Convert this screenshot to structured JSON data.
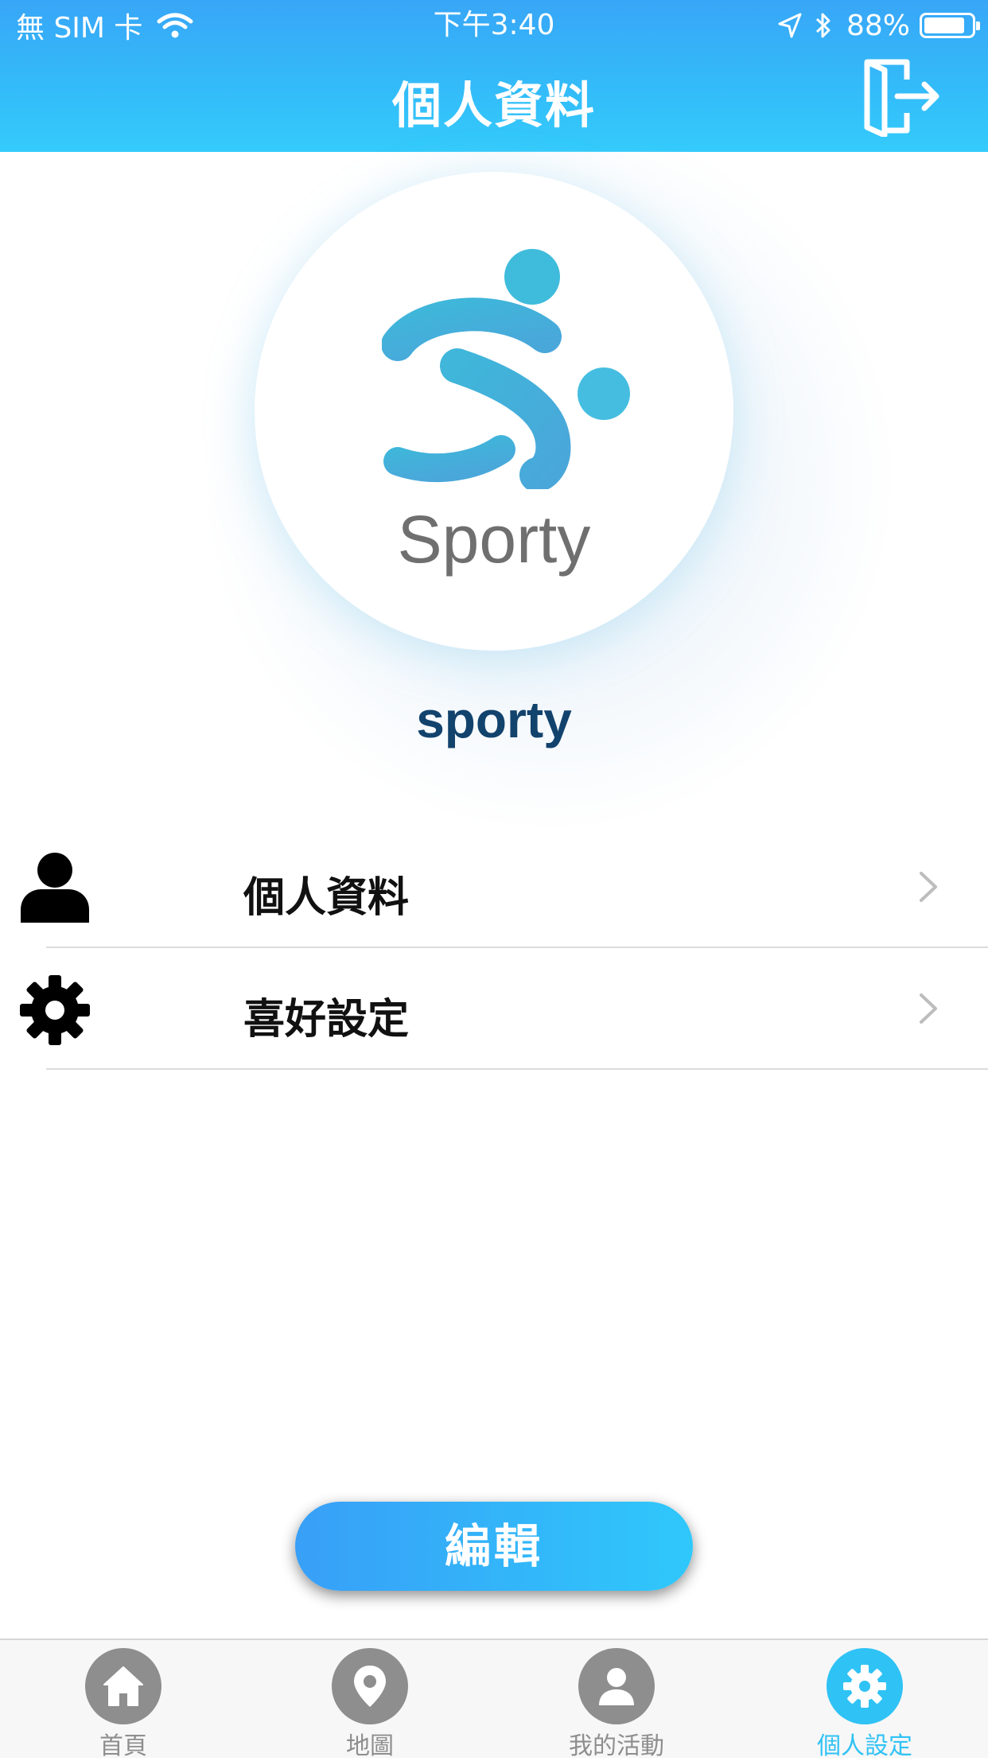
{
  "status_bar": {
    "carrier": "無 SIM 卡",
    "time": "下午3:40",
    "battery": "88%",
    "battery_level": 0.88,
    "icons": [
      "wifi-icon",
      "location-arrow-icon",
      "bluetooth-icon",
      "battery-icon"
    ]
  },
  "header": {
    "title": "個人資料",
    "logout_icon": "door-exit-icon",
    "colors": {
      "top": "#38a6f7",
      "bottom": "#34cbfb"
    }
  },
  "profile": {
    "logo_text": "Sporty",
    "username": "sporty",
    "logo_color": "#45b3dc",
    "username_color": "#12436d"
  },
  "menu": {
    "items": [
      {
        "label": "個人資料",
        "icon": "user-icon"
      },
      {
        "label": "喜好設定",
        "icon": "gear-icon"
      }
    ]
  },
  "edit_button": {
    "label": "編輯"
  },
  "tabbar": {
    "active_color": "#2fc2f5",
    "inactive_color": "#8e8e8e",
    "tabs": [
      {
        "label": "首頁",
        "icon": "home-icon",
        "active": false
      },
      {
        "label": "地圖",
        "icon": "map-pin-icon",
        "active": false
      },
      {
        "label": "我的活動",
        "icon": "person-icon",
        "active": false
      },
      {
        "label": "個人設定",
        "icon": "gear-icon",
        "active": true
      }
    ]
  }
}
